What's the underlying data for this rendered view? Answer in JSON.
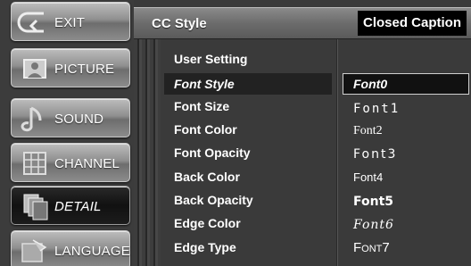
{
  "menu": [
    {
      "id": "exit",
      "label": "EXIT",
      "icon": "exit-arrow-icon",
      "active": false
    },
    {
      "id": "picture",
      "label": "PICTURE",
      "icon": "picture-icon",
      "active": false
    },
    {
      "id": "sound",
      "label": "SOUND",
      "icon": "sound-note-icon",
      "active": false
    },
    {
      "id": "channel",
      "label": "CHANNEL",
      "icon": "channel-grid-icon",
      "active": false
    },
    {
      "id": "detail",
      "label": "DETAIL",
      "icon": "detail-pages-icon",
      "active": true
    },
    {
      "id": "language",
      "label": "LANGUAGE",
      "icon": "language-icon",
      "active": false
    }
  ],
  "header": {
    "title": "CC Style",
    "badge": "Closed Caption"
  },
  "options": [
    "User Setting",
    "Font Style",
    "Font Size",
    "Font Color",
    "Font Opacity",
    "Back Color",
    "Back Opacity",
    "Edge Color",
    "Edge Type"
  ],
  "selected_option": "Font Style",
  "fonts": [
    "Font0",
    "Font1",
    "Font2",
    "Font3",
    "Font4",
    "Font5",
    "Font6",
    "Font7"
  ],
  "selected_font": "Font0",
  "colors": {
    "background": "#2e2e2e",
    "panel": "#3a3a3a",
    "highlight": "#111111",
    "text": "#ffffff"
  }
}
